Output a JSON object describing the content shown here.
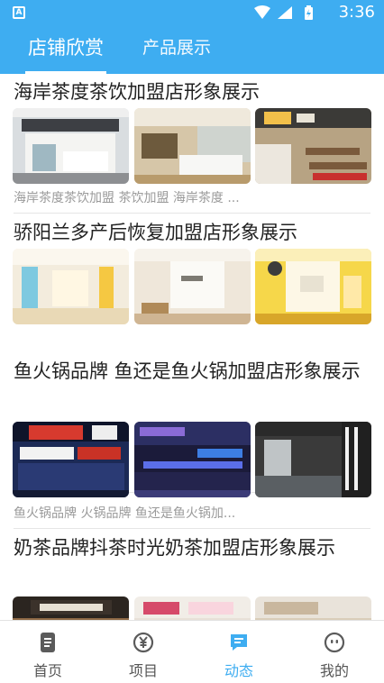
{
  "status_bar": {
    "time": "3:36",
    "notification_icon": "a-notification-icon"
  },
  "tabs": [
    {
      "label": "店铺欣赏",
      "active": true
    },
    {
      "label": "产品展示",
      "active": false
    }
  ],
  "cards": [
    {
      "title": "海岸茶度茶饮加盟店形象展示",
      "tags": "海岸茶度茶饮加盟 茶饮加盟 海岸茶度 ..."
    },
    {
      "title": "骄阳兰多产后恢复加盟店形象展示",
      "tags": ""
    },
    {
      "title": "鱼火锅品牌 鱼还是鱼火锅加盟店形象展示",
      "tags": "鱼火锅品牌 火锅品牌 鱼还是鱼火锅加..."
    },
    {
      "title": "奶茶品牌抖茶时光奶茶加盟店形象展示",
      "tags": ""
    }
  ],
  "bottom_nav": [
    {
      "label": "首页",
      "icon": "document-icon"
    },
    {
      "label": "项目",
      "icon": "yen-icon"
    },
    {
      "label": "动态",
      "icon": "message-icon",
      "active": true
    },
    {
      "label": "我的",
      "icon": "face-icon"
    }
  ],
  "colors": {
    "accent": "#3eadf1",
    "text": "#222222",
    "muted": "#9a9a9a"
  }
}
